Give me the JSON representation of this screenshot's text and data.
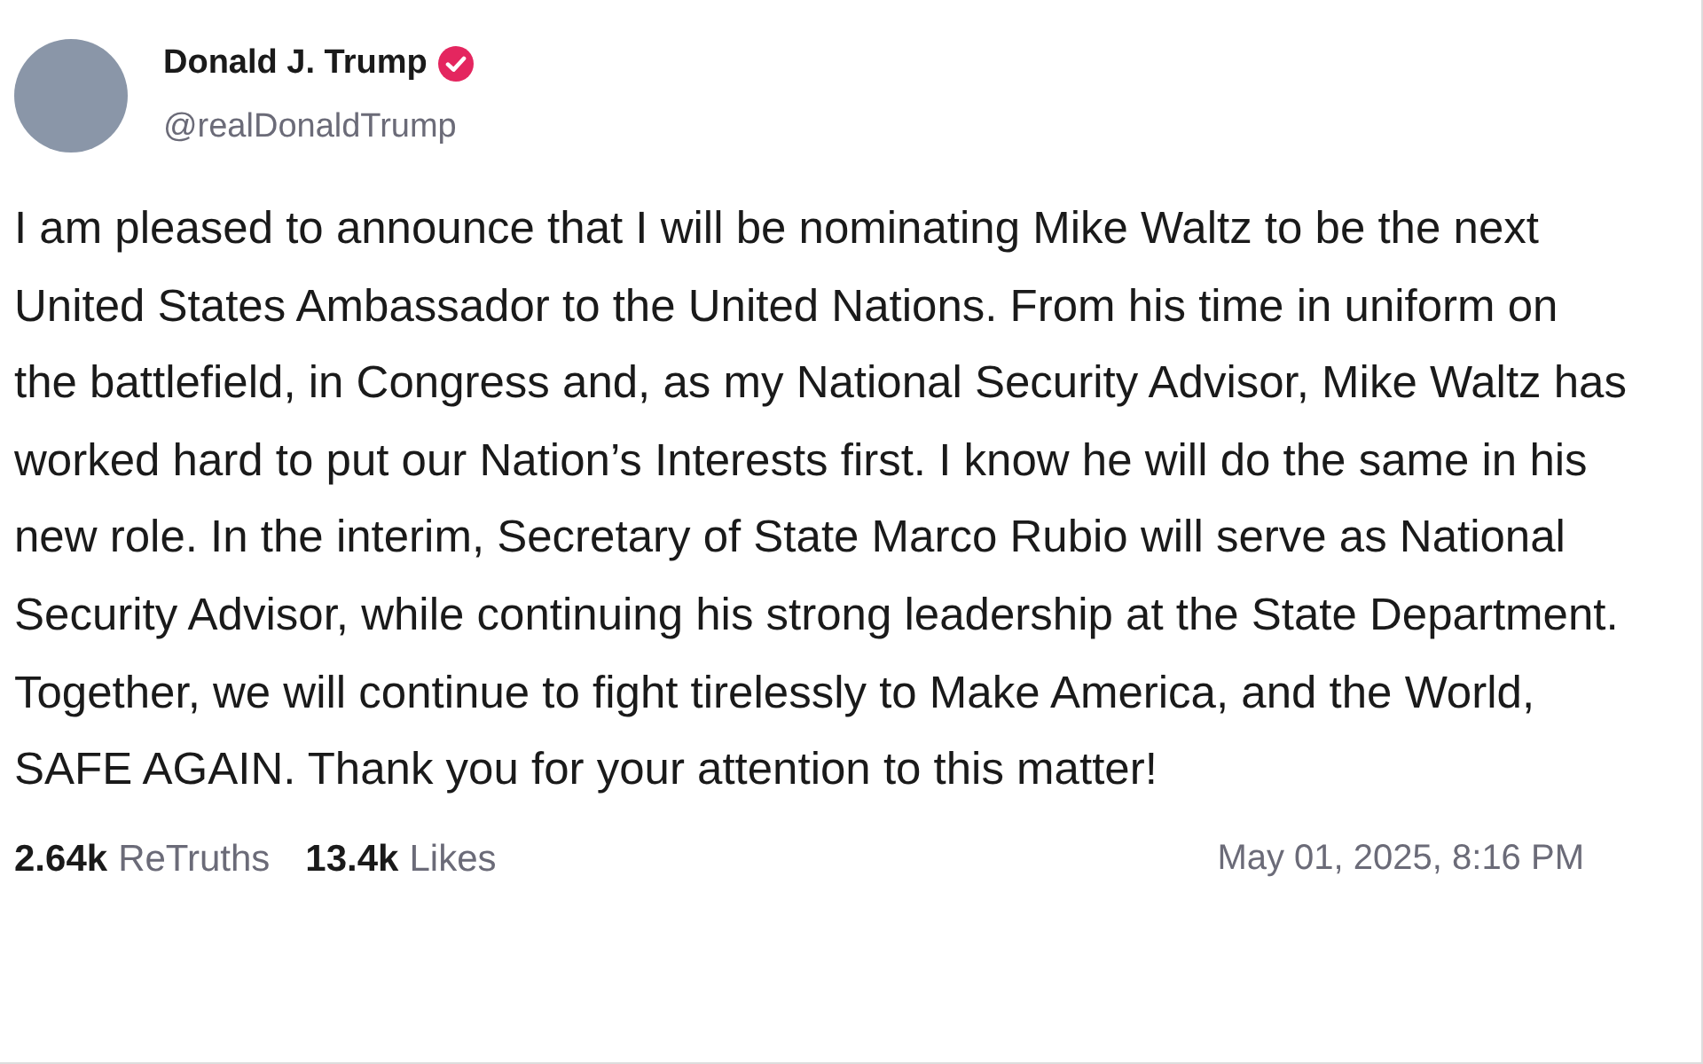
{
  "author": {
    "name": "Donald J. Trump",
    "handle": "@realDonaldTrump",
    "verified": true
  },
  "post": {
    "text": "I am pleased to announce that I will be nominating Mike Waltz to be the next United States Ambassador to the United Nations. From his time in uniform on the battlefield, in Congress and, as my National Security Advisor, Mike Waltz has worked hard to put our Nation’s Interests first. I know he will do the same in his new role. In the interim, Secretary of State Marco Rubio will serve as National Security Advisor, while continuing his strong leadership at the State Department. Together, we will continue to fight tirelessly to Make America, and the World, SAFE AGAIN. Thank you for your attention to this matter!"
  },
  "stats": [
    {
      "count": "2.64k",
      "label": "ReTruths"
    },
    {
      "count": "13.4k",
      "label": "Likes"
    }
  ],
  "timestamp": "May 01, 2025, 8:16 PM"
}
